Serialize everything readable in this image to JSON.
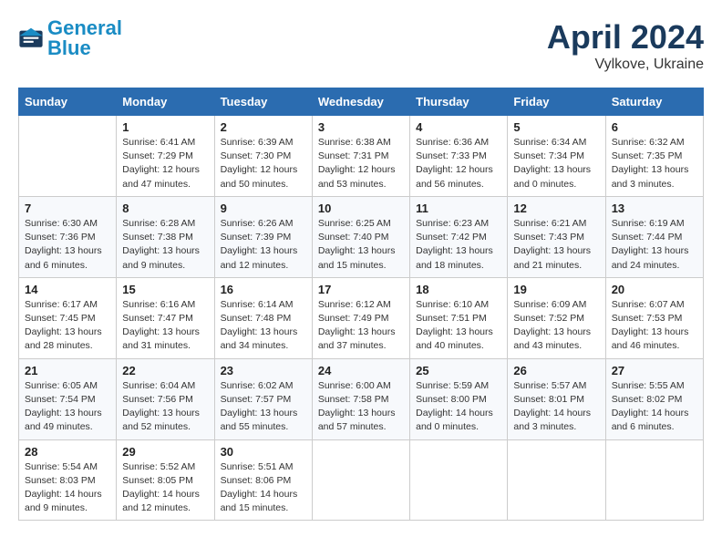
{
  "header": {
    "logo_general": "General",
    "logo_blue": "Blue",
    "month": "April 2024",
    "location": "Vylkove, Ukraine"
  },
  "weekdays": [
    "Sunday",
    "Monday",
    "Tuesday",
    "Wednesday",
    "Thursday",
    "Friday",
    "Saturday"
  ],
  "weeks": [
    [
      {
        "num": "",
        "info": ""
      },
      {
        "num": "1",
        "info": "Sunrise: 6:41 AM\nSunset: 7:29 PM\nDaylight: 12 hours\nand 47 minutes."
      },
      {
        "num": "2",
        "info": "Sunrise: 6:39 AM\nSunset: 7:30 PM\nDaylight: 12 hours\nand 50 minutes."
      },
      {
        "num": "3",
        "info": "Sunrise: 6:38 AM\nSunset: 7:31 PM\nDaylight: 12 hours\nand 53 minutes."
      },
      {
        "num": "4",
        "info": "Sunrise: 6:36 AM\nSunset: 7:33 PM\nDaylight: 12 hours\nand 56 minutes."
      },
      {
        "num": "5",
        "info": "Sunrise: 6:34 AM\nSunset: 7:34 PM\nDaylight: 13 hours\nand 0 minutes."
      },
      {
        "num": "6",
        "info": "Sunrise: 6:32 AM\nSunset: 7:35 PM\nDaylight: 13 hours\nand 3 minutes."
      }
    ],
    [
      {
        "num": "7",
        "info": "Sunrise: 6:30 AM\nSunset: 7:36 PM\nDaylight: 13 hours\nand 6 minutes."
      },
      {
        "num": "8",
        "info": "Sunrise: 6:28 AM\nSunset: 7:38 PM\nDaylight: 13 hours\nand 9 minutes."
      },
      {
        "num": "9",
        "info": "Sunrise: 6:26 AM\nSunset: 7:39 PM\nDaylight: 13 hours\nand 12 minutes."
      },
      {
        "num": "10",
        "info": "Sunrise: 6:25 AM\nSunset: 7:40 PM\nDaylight: 13 hours\nand 15 minutes."
      },
      {
        "num": "11",
        "info": "Sunrise: 6:23 AM\nSunset: 7:42 PM\nDaylight: 13 hours\nand 18 minutes."
      },
      {
        "num": "12",
        "info": "Sunrise: 6:21 AM\nSunset: 7:43 PM\nDaylight: 13 hours\nand 21 minutes."
      },
      {
        "num": "13",
        "info": "Sunrise: 6:19 AM\nSunset: 7:44 PM\nDaylight: 13 hours\nand 24 minutes."
      }
    ],
    [
      {
        "num": "14",
        "info": "Sunrise: 6:17 AM\nSunset: 7:45 PM\nDaylight: 13 hours\nand 28 minutes."
      },
      {
        "num": "15",
        "info": "Sunrise: 6:16 AM\nSunset: 7:47 PM\nDaylight: 13 hours\nand 31 minutes."
      },
      {
        "num": "16",
        "info": "Sunrise: 6:14 AM\nSunset: 7:48 PM\nDaylight: 13 hours\nand 34 minutes."
      },
      {
        "num": "17",
        "info": "Sunrise: 6:12 AM\nSunset: 7:49 PM\nDaylight: 13 hours\nand 37 minutes."
      },
      {
        "num": "18",
        "info": "Sunrise: 6:10 AM\nSunset: 7:51 PM\nDaylight: 13 hours\nand 40 minutes."
      },
      {
        "num": "19",
        "info": "Sunrise: 6:09 AM\nSunset: 7:52 PM\nDaylight: 13 hours\nand 43 minutes."
      },
      {
        "num": "20",
        "info": "Sunrise: 6:07 AM\nSunset: 7:53 PM\nDaylight: 13 hours\nand 46 minutes."
      }
    ],
    [
      {
        "num": "21",
        "info": "Sunrise: 6:05 AM\nSunset: 7:54 PM\nDaylight: 13 hours\nand 49 minutes."
      },
      {
        "num": "22",
        "info": "Sunrise: 6:04 AM\nSunset: 7:56 PM\nDaylight: 13 hours\nand 52 minutes."
      },
      {
        "num": "23",
        "info": "Sunrise: 6:02 AM\nSunset: 7:57 PM\nDaylight: 13 hours\nand 55 minutes."
      },
      {
        "num": "24",
        "info": "Sunrise: 6:00 AM\nSunset: 7:58 PM\nDaylight: 13 hours\nand 57 minutes."
      },
      {
        "num": "25",
        "info": "Sunrise: 5:59 AM\nSunset: 8:00 PM\nDaylight: 14 hours\nand 0 minutes."
      },
      {
        "num": "26",
        "info": "Sunrise: 5:57 AM\nSunset: 8:01 PM\nDaylight: 14 hours\nand 3 minutes."
      },
      {
        "num": "27",
        "info": "Sunrise: 5:55 AM\nSunset: 8:02 PM\nDaylight: 14 hours\nand 6 minutes."
      }
    ],
    [
      {
        "num": "28",
        "info": "Sunrise: 5:54 AM\nSunset: 8:03 PM\nDaylight: 14 hours\nand 9 minutes."
      },
      {
        "num": "29",
        "info": "Sunrise: 5:52 AM\nSunset: 8:05 PM\nDaylight: 14 hours\nand 12 minutes."
      },
      {
        "num": "30",
        "info": "Sunrise: 5:51 AM\nSunset: 8:06 PM\nDaylight: 14 hours\nand 15 minutes."
      },
      {
        "num": "",
        "info": ""
      },
      {
        "num": "",
        "info": ""
      },
      {
        "num": "",
        "info": ""
      },
      {
        "num": "",
        "info": ""
      }
    ]
  ]
}
